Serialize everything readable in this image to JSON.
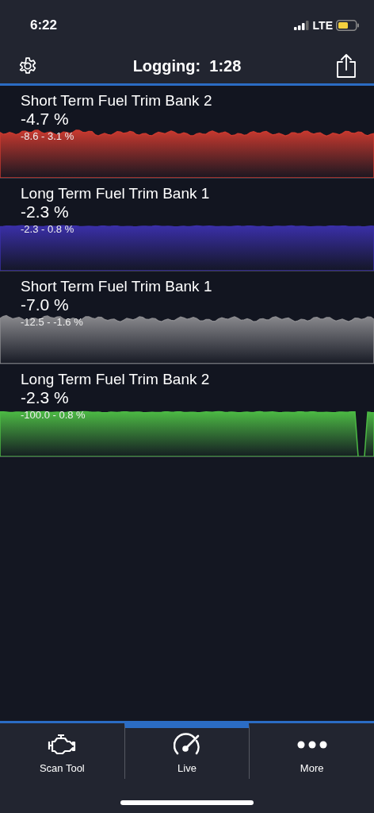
{
  "status_bar": {
    "time": "6:22",
    "network": "LTE"
  },
  "header": {
    "title": "Logging:  1:28"
  },
  "gauges": [
    {
      "title": "Short Term Fuel Trim Bank 2",
      "value": "-4.7 %",
      "range": "-8.6 - 3.1 %",
      "color": "#c8392f"
    },
    {
      "title": "Long Term Fuel Trim Bank 1",
      "value": "-2.3 %",
      "range": "-2.3 - 0.8 %",
      "color": "#3a2fa8"
    },
    {
      "title": "Short Term Fuel Trim Bank 1",
      "value": "-7.0 %",
      "range": "-12.5 - -1.6 %",
      "color": "#8a8a8e"
    },
    {
      "title": "Long Term Fuel Trim Bank 2",
      "value": "-2.3 %",
      "range": "-100.0 - 0.8 %",
      "color": "#4cb944"
    }
  ],
  "tabs": [
    {
      "label": "Scan Tool",
      "selected": false
    },
    {
      "label": "Live",
      "selected": true
    },
    {
      "label": "More",
      "selected": false
    }
  ]
}
